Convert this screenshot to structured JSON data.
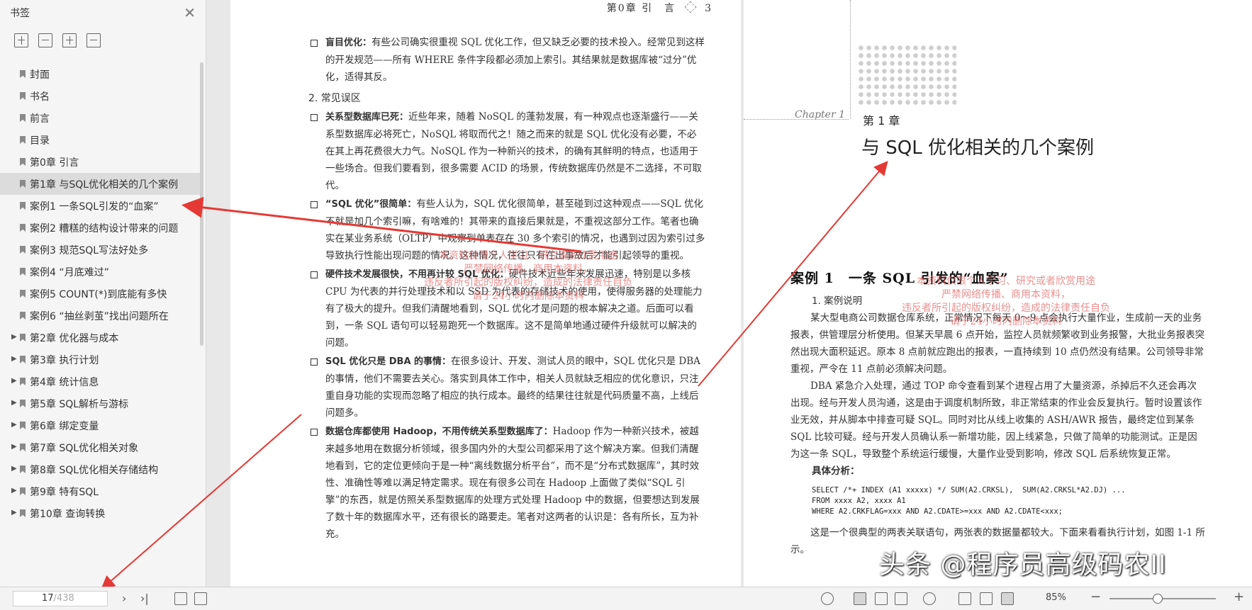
{
  "sidebar": {
    "title": "书签",
    "close": "✕",
    "items": [
      {
        "label": "封面"
      },
      {
        "label": "书名"
      },
      {
        "label": "前言"
      },
      {
        "label": "目录"
      },
      {
        "label": "第0章 引言"
      },
      {
        "label": "第1章 与SQL优化相关的几个案例"
      },
      {
        "label": "案例1 一条SQL引发的“血案”"
      },
      {
        "label": "案例2 糟糕的结构设计带来的问题"
      },
      {
        "label": "案例3 规范SQL写法好处多"
      },
      {
        "label": "案例4 “月底难过”"
      },
      {
        "label": "案例5 COUNT(*)到底能有多快"
      },
      {
        "label": "案例6 “抽丝剥茧”找出问题所在"
      },
      {
        "label": "第2章 优化器与成本"
      },
      {
        "label": "第3章 执行计划"
      },
      {
        "label": "第4章 统计信息"
      },
      {
        "label": "第5章 SQL解析与游标"
      },
      {
        "label": "第6章 绑定变量"
      },
      {
        "label": "第7章 SQL优化相关对象"
      },
      {
        "label": "第8章 SQL优化相关存储结构"
      },
      {
        "label": "第9章 特有SQL"
      },
      {
        "label": "第10章 查询转换"
      }
    ]
  },
  "left_page": {
    "header_chapter": "第0章",
    "header_title": "引　言",
    "header_num": "3",
    "p1_bold": "盲目优化：",
    "p1_text": "有些公司确实很重视 SQL 优化工作，但又缺乏必要的技术投入。经常见到这样的开发规范——所有 WHERE 条件字段都必须加上索引。其结果就是数据库被“过分”优化，适得其反。",
    "sec2": "2. 常见误区",
    "b1_bold": "关系型数据库已死：",
    "b1_text": "近些年来，随着 NoSQL 的蓬勃发展，有一种观点也逐渐盛行——关系型数据库必将死亡，NoSQL 将取而代之！随之而来的就是 SQL 优化没有必要，不必在其上再花费很大力气。NoSQL 作为一种新兴的技术，的确有其鲜明的特点，也适用于一些场合。但我们要看到，很多需要 ACID 的场景，传统数据库仍然是不二选择，不可取代。",
    "b2_bold": "“SQL 优化”很简单：",
    "b2_text": "有些人认为，SQL 优化很简单，甚至碰到过这种观点——SQL 优化不就是加几个索引嘛，有啥难的！其带来的直接后果就是，不重视这部分工作。笔者也确实在某业务系统（OLTP）中观察到单表存在 30 多个索引的情况，也遇到过因为索引过多导致执行性能出现问题的情况。这种情况，往往只有在出事故后才能引起领导的重视。",
    "b3_bold": "硬件技术发展很快，不用再计较 SQL 优化：",
    "b3_text": "硬件技术近些年来发展迅速，特别是以多核 CPU 为代表的并行处理技术和以 SSD 为代表的存储技术的使用，使得服务器的处理能力有了极大的提升。但我们清醒地看到，SQL 优化才是问题的根本解决之道。后面可以看到，一条 SQL 语句可以轻易跑死一个数据库。这不是简单地通过硬件升级就可以解决的问题。",
    "b4_bold": "SQL 优化只是 DBA 的事情：",
    "b4_text": "在很多设计、开发、测试人员的眼中，SQL 优化只是 DBA 的事情，他们不需要去关心。落实到具体工作中，相关人员就缺乏相应的优化意识，只注重自身功能的实现而忽略了相应的执行成本。最终的结果往往就是代码质量不高，上线后问题多。",
    "b5_bold": "数据仓库都使用 Hadoop，不用传统关系型数据库了：",
    "b5_text": "Hadoop 作为一种新兴技术，被越来越多地用在数据分析领域，很多国内外的大型公司都采用了这个解决方案。但我们清醒地看到，它的定位更倾向于是一种“离线数据分析平台”，而不是“分布式数据库”，其时效性、准确性等难以满足特定需求。现在有很多公司在 Hadoop 上面做了类似“SQL 引擎”的东西，就是仿照关系型数据库的处理方式处理 Hadoop 中的数据，但要想达到发展了数十年的数据库水平，还有很长的路要走。笔者对这两者的认识是：各有所长，互为补充。",
    "wm_lines": [
      "本资料仅限个人学习、研究或者欣赏用途",
      "严禁网络传播、商用本资料，",
      "违反者所引起的版权纠纷，造成的法律责任自负",
      "请于24小时内删除本资料"
    ]
  },
  "right_page": {
    "chapter_script": "Chapter 1",
    "chapter_no": "第 1 章",
    "chapter_title": "与 SQL 优化相关的几个案例",
    "case_title": "案例 1　一条 SQL 引发的“血案”",
    "sub1": "1. 案例说明",
    "para1": "某大型电商公司数据仓库系统，正常情况下每天 0～9 点会执行大量作业，生成前一天的业务报表，供管理层分析使用。但某天早晨 6 点开始，监控人员就频繁收到业务报警，大批业务报表突然出现大面积延迟。原本 8 点前就应跑出的报表，一直持续到 10 点仍然没有结果。公司领导非常重视，严令在 11 点前必须解决问题。",
    "para2": "DBA 紧急介入处理，通过 TOP 命令查看到某个进程占用了大量资源，杀掉后不久还会再次出现。经与开发人员沟通，这是由于调度机制所致，非正常结束的作业会反复执行。暂时设置该作业无效，并从脚本中排查可疑 SQL。同时对比从线上收集的 ASH/AWR 报告，最终定位到某条 SQL 比较可疑。经与开发人员确认系一新增功能，因上线紧急，只做了简单的功能测试。正是因为这一条 SQL，导致整个系统运行缓慢，大量作业受到影响，修改 SQL 后系统恢复正常。",
    "sub2": "具体分析：",
    "code": "SELECT /*+ INDEX (A1 xxxxx) */ SUM(A2.CRKSL),  SUM(A2.CRKSL*A2.DJ) ...\nFROM xxxx A2, xxxx A1\nWHERE A2.CRKFLAG=xxx AND A2.CDATE>=xxx AND A2.CDATE<xxx;",
    "para3": "这是一个很典型的两表关联语句，两张表的数据量都较大。下面来看看执行计划，如图 1-1 所示。",
    "wm_lines": [
      "本资料仅限个人学习、研究或者欣赏用途",
      "严禁网络传播、商用本资料，",
      "违反者所引起的版权纠纷，造成的法律责任自负",
      "请于24小时内删除本资料"
    ]
  },
  "watermark_brand": "头条 @程序员高级码农II",
  "bottombar": {
    "page_current": "17",
    "page_total": "/438",
    "zoom": "85%"
  }
}
